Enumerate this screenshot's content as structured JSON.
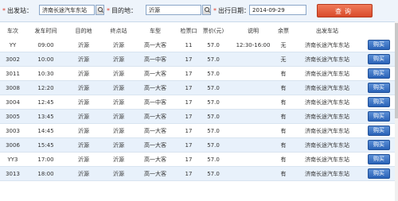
{
  "search": {
    "from_label": "出发站：",
    "from_value": "济南长途汽车东站",
    "to_label": "目的地：",
    "to_value": "沂源",
    "date_label": "出行日期：",
    "date_value": "2014-09-29",
    "query_button": "查询",
    "required_mark": "*"
  },
  "table": {
    "headers": [
      "车次",
      "发车时间",
      "目的地",
      "终点站",
      "车型",
      "检票口",
      "票价(元)",
      "说明",
      "余票",
      "出发车站"
    ],
    "buy_label": "购买",
    "rows": [
      {
        "trip": "YY",
        "time": "09:00",
        "dest": "沂源",
        "terminal": "沂源",
        "type": "高一大客",
        "gate": "11",
        "price": "57.0",
        "note": "12:30-16:00",
        "remaining": "无",
        "station": "济南长途汽车东站"
      },
      {
        "trip": "3002",
        "time": "10:00",
        "dest": "沂源",
        "terminal": "沂源",
        "type": "高一中客",
        "gate": "17",
        "price": "57.0",
        "note": "",
        "remaining": "无",
        "station": "济南长途汽车东站"
      },
      {
        "trip": "3011",
        "time": "10:30",
        "dest": "沂源",
        "terminal": "沂源",
        "type": "高一大客",
        "gate": "17",
        "price": "57.0",
        "note": "",
        "remaining": "有",
        "station": "济南长途汽车东站"
      },
      {
        "trip": "3008",
        "time": "12:20",
        "dest": "沂源",
        "terminal": "沂源",
        "type": "高一大客",
        "gate": "17",
        "price": "57.0",
        "note": "",
        "remaining": "有",
        "station": "济南长途汽车东站"
      },
      {
        "trip": "3004",
        "time": "12:45",
        "dest": "沂源",
        "terminal": "沂源",
        "type": "高一中客",
        "gate": "17",
        "price": "57.0",
        "note": "",
        "remaining": "有",
        "station": "济南长途汽车东站"
      },
      {
        "trip": "3005",
        "time": "13:45",
        "dest": "沂源",
        "terminal": "沂源",
        "type": "高一大客",
        "gate": "17",
        "price": "57.0",
        "note": "",
        "remaining": "有",
        "station": "济南长途汽车东站"
      },
      {
        "trip": "3003",
        "time": "14:45",
        "dest": "沂源",
        "terminal": "沂源",
        "type": "高一大客",
        "gate": "17",
        "price": "57.0",
        "note": "",
        "remaining": "有",
        "station": "济南长途汽车东站"
      },
      {
        "trip": "3006",
        "time": "15:45",
        "dest": "沂源",
        "terminal": "沂源",
        "type": "高一大客",
        "gate": "17",
        "price": "57.0",
        "note": "",
        "remaining": "有",
        "station": "济南长途汽车东站"
      },
      {
        "trip": "YY3",
        "time": "17:00",
        "dest": "沂源",
        "terminal": "沂源",
        "type": "高一大客",
        "gate": "17",
        "price": "57.0",
        "note": "",
        "remaining": "有",
        "station": "济南长途汽车东站"
      },
      {
        "trip": "3013",
        "time": "18:00",
        "dest": "沂源",
        "terminal": "沂源",
        "type": "高一大客",
        "gate": "17",
        "price": "57.0",
        "note": "",
        "remaining": "有",
        "station": "济南长途汽车东站"
      }
    ]
  },
  "colors": {
    "query_button": "#d94a2a",
    "buy_button": "#2a63b8",
    "row_alt": "#e8f1fb",
    "required_mark": "#e03b2b"
  },
  "icons": {
    "picker": "magnifier-icon"
  }
}
